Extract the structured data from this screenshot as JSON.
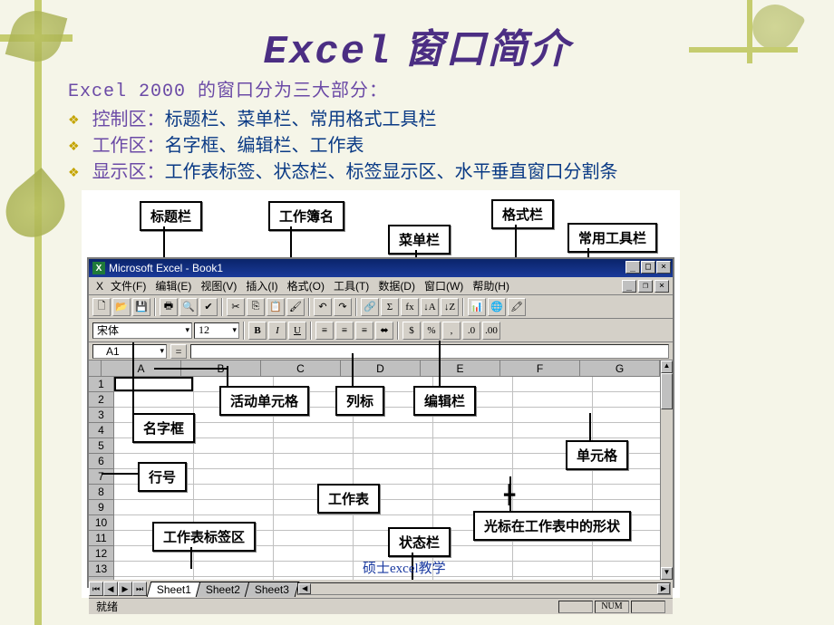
{
  "title_en": "Excel",
  "title_cn": "窗口简介",
  "intro": "Excel 2000 的窗口分为三大部分：",
  "bullets": [
    {
      "label": "控制区：",
      "rest": "标题栏、菜单栏、常用格式工具栏"
    },
    {
      "label": "工作区：",
      "rest": "名字框、编辑栏、工作表"
    },
    {
      "label": "显示区：",
      "rest": "工作表标签、状态栏、标签显示区、水平垂直窗口分割条"
    }
  ],
  "callouts": {
    "titlebar": "标题栏",
    "workbook": "工作簿名",
    "formatbar": "格式栏",
    "menubar": "菜单栏",
    "toolbar": "常用工具栏",
    "activecell": "活动单元格",
    "collabel": "列标",
    "editbar": "编辑栏",
    "namebox": "名字框",
    "rowlabel": "行号",
    "cell": "单元格",
    "worksheet": "工作表",
    "cursor": "光标在工作表中的形状",
    "tabarea": "工作表标签区",
    "statusbar": "状态栏"
  },
  "excel": {
    "title": "Microsoft Excel - Book1",
    "menus": [
      "文件(F)",
      "编辑(E)",
      "视图(V)",
      "插入(I)",
      "格式(O)",
      "工具(T)",
      "数据(D)",
      "窗口(W)",
      "帮助(H)"
    ],
    "font": "宋体",
    "fontsize": "12",
    "namebox": "A1",
    "cols": [
      "A",
      "B",
      "C",
      "D",
      "E",
      "F",
      "G"
    ],
    "rows": [
      "1",
      "2",
      "3",
      "4",
      "5",
      "6",
      "7",
      "8",
      "9",
      "10",
      "11",
      "12",
      "13"
    ],
    "tabs": [
      "Sheet1",
      "Sheet2",
      "Sheet3"
    ],
    "status": "就绪",
    "statusbox": "NUM"
  },
  "credit": "硕士excel教学"
}
